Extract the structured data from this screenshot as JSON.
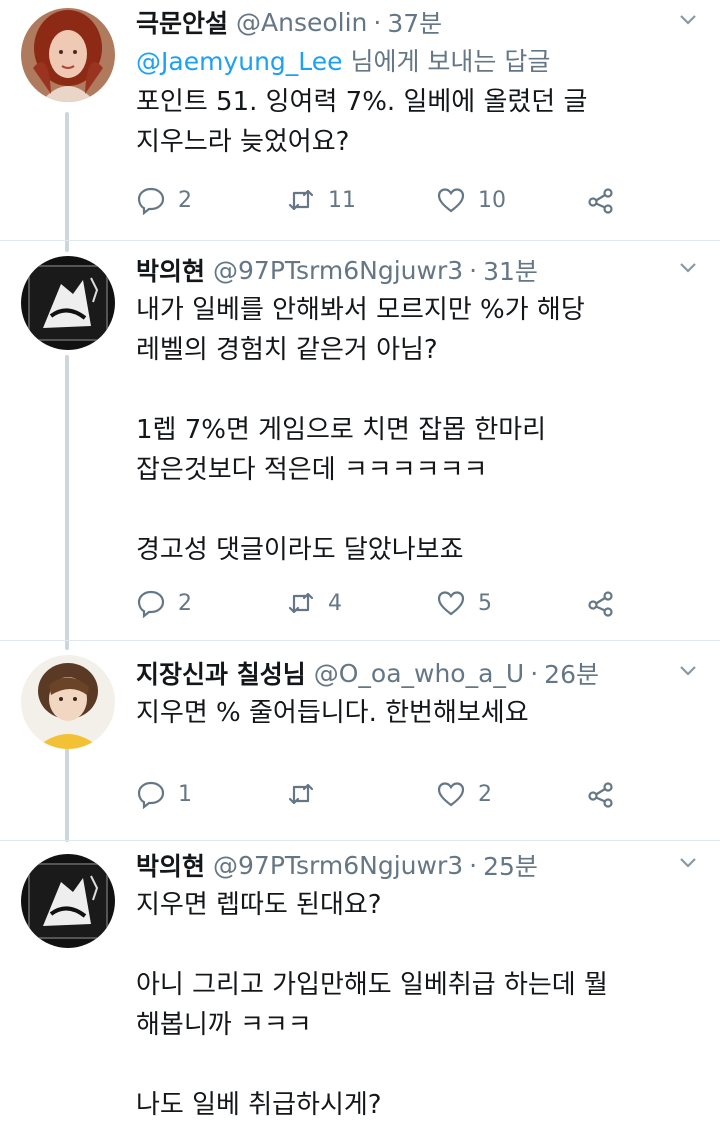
{
  "tweets": [
    {
      "name": "극문안설",
      "handle": "@Anseolin",
      "time": "37분",
      "reply_prefix": "",
      "reply_mention": "@Jaemyung_Lee",
      "reply_suffix": " 님에게 보내는 답글",
      "text": "포인트 51. 잉여력 7%. 일베에 올렸던 글\n지우느라 늦었어요?",
      "replies": "2",
      "retweets": "11",
      "likes": "10"
    },
    {
      "name": "박의현",
      "handle": "@97PTsrm6Ngjuwr3",
      "time": "31분",
      "text": "내가 일베를 안해봐서 모르지만 %가 해당\n레벨의 경험치 같은거 아님?\n\n1렙 7%면 게임으로 치면 잡몹 한마리\n잡은것보다 적은데 ㅋㅋㅋㅋㅋㅋ\n\n경고성 댓글이라도 달았나보죠",
      "replies": "2",
      "retweets": "4",
      "likes": "5"
    },
    {
      "name": "지장신과 칠성님",
      "handle": "@O_oa_who_a_U",
      "time": "26분",
      "text": "지우면 % 줄어듭니다. 한번해보세요",
      "replies": "1",
      "retweets": "",
      "likes": "2"
    },
    {
      "name": "박의현",
      "handle": "@97PTsrm6Ngjuwr3",
      "time": "25분",
      "text": "지우면 렙따도 된대요?\n\n아니 그리고 가입만해도 일베취급 하는데 뭘\n해봅니까 ㅋㅋㅋ\n\n나도 일베 취급하시게?"
    }
  ],
  "separator": "·",
  "icons": {
    "reply": "reply-icon",
    "retweet": "retweet-icon",
    "like": "heart-icon",
    "share": "share-icon",
    "caret": "chevron-down-icon"
  },
  "colors": {
    "text": "#14171a",
    "secondary": "#657786",
    "link": "#1da1f2",
    "thread_line": "#ccd6dd"
  }
}
